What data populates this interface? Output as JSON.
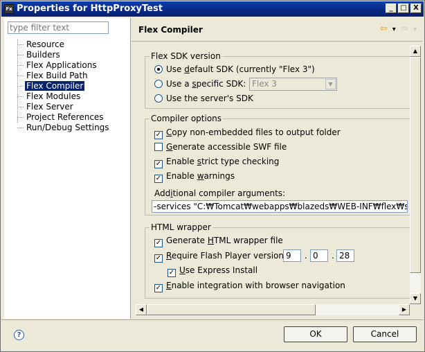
{
  "window": {
    "title": "Properties for HttpProxyTest",
    "app_icon_text": "Fx",
    "minimize_glyph": "_",
    "maximize_glyph": "□",
    "close_glyph": "X"
  },
  "sidebar": {
    "filter_placeholder": "type filter text",
    "items": [
      {
        "label": "Resource"
      },
      {
        "label": "Builders"
      },
      {
        "label": "Flex Applications"
      },
      {
        "label": "Flex Build Path"
      },
      {
        "label": "Flex Compiler",
        "selected": true
      },
      {
        "label": "Flex Modules"
      },
      {
        "label": "Flex Server"
      },
      {
        "label": "Project References"
      },
      {
        "label": "Run/Debug Settings"
      }
    ]
  },
  "page": {
    "title": "Flex Compiler",
    "nav_back_icon": "⇦",
    "nav_back_dropdown": "▾",
    "nav_forward_icon": "⇨",
    "nav_forward_dropdown": "▾"
  },
  "sdk": {
    "group_title": "Flex SDK version",
    "opt_default_pre": "Use ",
    "opt_default_u": "d",
    "opt_default_post": "efault SDK (currently \"Flex 3\")",
    "opt_specific_pre": "Use a ",
    "opt_specific_u": "s",
    "opt_specific_post": "pecific SDK:",
    "specific_combo_value": "Flex 3",
    "opt_server": "Use the server's SDK",
    "selected": "default"
  },
  "compiler": {
    "group_title": "Compiler options",
    "copy_files_u": "C",
    "copy_files_post": "opy non-embedded files to output folder",
    "copy_files_checked": true,
    "accessible_u": "G",
    "accessible_post": "enerate accessible SWF file",
    "accessible_checked": false,
    "strict_pre": "Enable ",
    "strict_u": "s",
    "strict_post": "trict type checking",
    "strict_checked": true,
    "warnings_pre": "Enable ",
    "warnings_u": "w",
    "warnings_post": "arnings",
    "warnings_checked": true,
    "args_label_pre": "Add",
    "args_label_u": "i",
    "args_label_post": "tional compiler arguments:",
    "args_value": "-services \"C:₩Tomcat₩webapps₩blazeds₩WEB-INF₩flex₩services-config.xml\" -locale en_US"
  },
  "wrapper": {
    "group_title": "HTML wrapper",
    "generate_pre": "Generate ",
    "generate_u": "H",
    "generate_post": "TML wrapper file",
    "generate_checked": true,
    "require_u": "R",
    "require_post": "equire Flash Player version:",
    "require_checked": true,
    "version_major": "9",
    "version_minor": "0",
    "version_revision": "28",
    "version_sep": ".",
    "express_u": "U",
    "express_post": "se Express Install",
    "express_checked": true,
    "browser_u": "E",
    "browser_post": "nable integration with browser navigation",
    "browser_checked": true
  },
  "buttons": {
    "help_icon": "?",
    "ok_label": "OK",
    "cancel_label": "Cancel"
  },
  "scroll": {
    "up": "▲",
    "down": "▼",
    "left": "◀",
    "right": "▶",
    "check_glyph": "✓"
  }
}
